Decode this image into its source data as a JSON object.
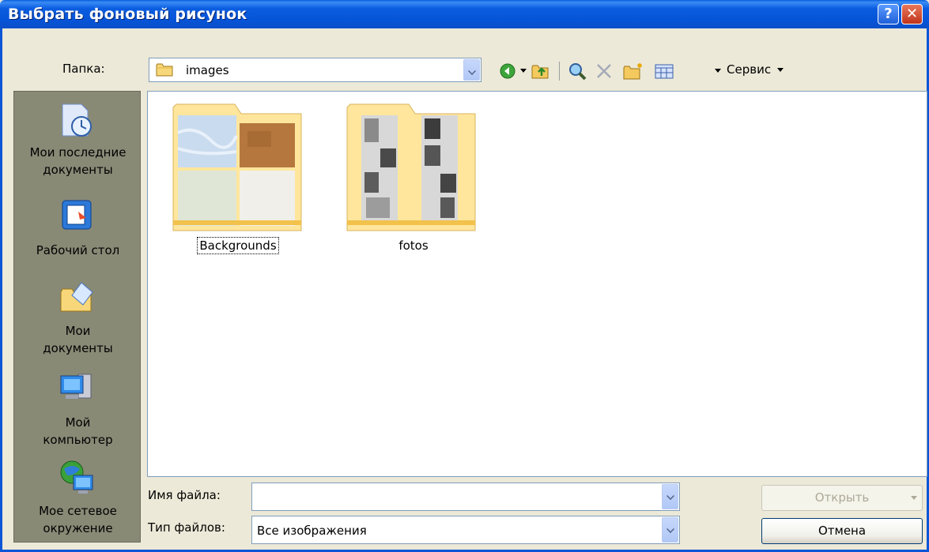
{
  "window": {
    "title": "Выбрать фоновый рисунок",
    "help_glyph": "?",
    "close_glyph": "✕"
  },
  "folder": {
    "label": "Папка:",
    "value": "images"
  },
  "toolbar": {
    "service_label": "Сервис",
    "icons": [
      "back-icon",
      "up-folder-icon",
      "search-web-icon",
      "delete-icon",
      "new-folder-icon",
      "views-icon"
    ]
  },
  "places": [
    {
      "label_line1": "Мои последние",
      "label_line2": "документы",
      "icon": "recent-documents-icon"
    },
    {
      "label_line1": "Рабочий стол",
      "label_line2": "",
      "icon": "desktop-icon"
    },
    {
      "label_line1": "Мои",
      "label_line2": "документы",
      "icon": "my-documents-icon"
    },
    {
      "label_line1": "Мой",
      "label_line2": "компьютер",
      "icon": "my-computer-icon"
    },
    {
      "label_line1": "Мое сетевое",
      "label_line2": "окружение",
      "icon": "network-icon"
    }
  ],
  "files": [
    {
      "name": "Backgrounds",
      "selected": true
    },
    {
      "name": "fotos",
      "selected": false
    }
  ],
  "filename": {
    "label": "Имя файла:",
    "value": ""
  },
  "filetype": {
    "label": "Тип файлов:",
    "value": "Все изображения"
  },
  "buttons": {
    "open": "Открыть",
    "cancel": "Отмена"
  },
  "colors": {
    "titlebar": "#0654d8",
    "dialog_bg": "#ece9d8",
    "places_bg": "#888a76"
  }
}
